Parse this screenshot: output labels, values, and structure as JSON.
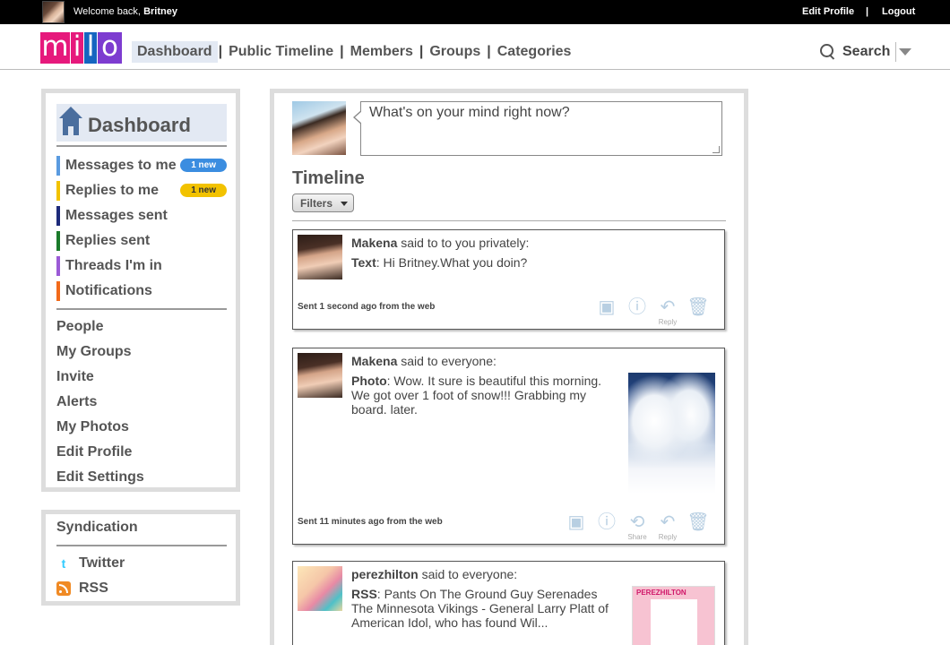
{
  "topbar": {
    "welcome_prefix": "Welcome back,",
    "user_name": "Britney",
    "edit_profile": "Edit Profile",
    "separator": "|",
    "logout": "Logout"
  },
  "logo": {
    "letters": [
      "m",
      "i",
      "l",
      "o"
    ]
  },
  "nav": {
    "items": [
      "Dashboard",
      "Public Timeline",
      "Members",
      "Groups",
      "Categories"
    ],
    "active": "Dashboard",
    "separator": "|"
  },
  "search": {
    "label": "Search"
  },
  "sidebar": {
    "title": "Dashboard",
    "colored_items": [
      {
        "label": "Messages to me",
        "color": "#5a9be0",
        "badge": "1 new",
        "badge_color": "#3b8de0"
      },
      {
        "label": "Replies to me",
        "color": "#f2c200",
        "badge": "1 new",
        "badge_color": "#f2c200"
      },
      {
        "label": "Messages sent",
        "color": "#1d2a7a"
      },
      {
        "label": "Replies sent",
        "color": "#1a7a2a"
      },
      {
        "label": "Threads I'm in",
        "color": "#9b5ad6"
      },
      {
        "label": "Notifications",
        "color": "#f26a1a"
      }
    ],
    "items": [
      "People",
      "My Groups",
      "Invite",
      "Alerts",
      "My Photos",
      "Edit Profile",
      "Edit Settings"
    ]
  },
  "syndication": {
    "title": "Syndication",
    "items": [
      {
        "label": "Twitter",
        "icon": "twitter-icon"
      },
      {
        "label": "RSS",
        "icon": "rss-icon"
      }
    ]
  },
  "main": {
    "status_placeholder": "What's on your mind right now?",
    "timeline_title": "Timeline",
    "filters_label": "Filters",
    "posts": [
      {
        "author": "Makena",
        "audience": "said to to you privately:",
        "type_label": "Text",
        "text": ": Hi Britney.What you doin?",
        "sent": "Sent 1 second ago from the web",
        "actions": [
          {
            "icon": "profile-card-icon",
            "caption": ""
          },
          {
            "icon": "info-icon",
            "caption": ""
          },
          {
            "icon": "reply-icon",
            "caption": "Reply"
          },
          {
            "icon": "trash-icon",
            "caption": ""
          }
        ]
      },
      {
        "author": "Makena",
        "audience": "said to everyone:",
        "type_label": "Photo",
        "text": ": Wow. It sure is beautiful this morning. We got over 1 foot of snow!!! Grabbing my board. later.",
        "sent": "Sent 11 minutes ago from the web",
        "actions": [
          {
            "icon": "profile-card-icon",
            "caption": ""
          },
          {
            "icon": "info-icon",
            "caption": ""
          },
          {
            "icon": "share-icon",
            "caption": "Share"
          },
          {
            "icon": "reply-icon",
            "caption": "Reply"
          },
          {
            "icon": "trash-icon",
            "caption": ""
          }
        ]
      },
      {
        "author": "perezhilton",
        "audience": "said to everyone:",
        "type_label": "RSS",
        "text": ": Pants On The Ground Guy Serenades The Minnesota Vikings - General Larry Platt of American Idol, who has found Wil...",
        "thumb_header": "PEREZHILTON"
      }
    ]
  }
}
